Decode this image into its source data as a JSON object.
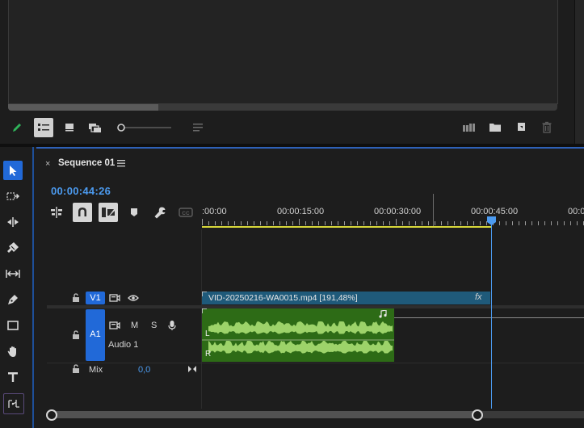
{
  "project_panel": {
    "toolbar": {
      "icons": [
        "pencil-icon",
        "list-view-icon",
        "icon-view-icon",
        "freeform-view-icon",
        "zoom-slider",
        "sort-icon",
        "automate-to-sequence-icon",
        "new-bin-icon",
        "new-item-icon",
        "trash-icon"
      ]
    }
  },
  "tools": [
    "selection-tool",
    "track-select-forward-tool",
    "ripple-edit-tool",
    "razor-tool",
    "slip-tool",
    "pen-tool",
    "rectangle-tool",
    "hand-tool",
    "type-tool",
    "remix-tool"
  ],
  "sequence": {
    "close_glyph": "×",
    "title": "Sequence 01",
    "timecode": "00:00:44:26",
    "ruler_labels": [
      ":00:00",
      "00:00:15:00",
      "00:00:30:00",
      "00:00:45:00",
      "00:0"
    ]
  },
  "tracks": {
    "v1_label": "V1",
    "a1_label": "A1",
    "a1_name": "Audio 1",
    "mute_label": "M",
    "solo_label": "S",
    "mix_label": "Mix",
    "mix_value": "0,0"
  },
  "clips": {
    "video_clip_name": "VID-20250216-WA0015.mp4 [191,48%]",
    "fx_label": "fx",
    "audio_left_label": "L",
    "audio_right_label": "R"
  },
  "colors": {
    "accent_blue": "#4c9bf0",
    "active_tool": "#2169d8",
    "video_clip": "#1f5a7a",
    "audio_clip": "#2d6b16",
    "waveform": "#9dd36a",
    "work_area": "#d8d83a"
  }
}
